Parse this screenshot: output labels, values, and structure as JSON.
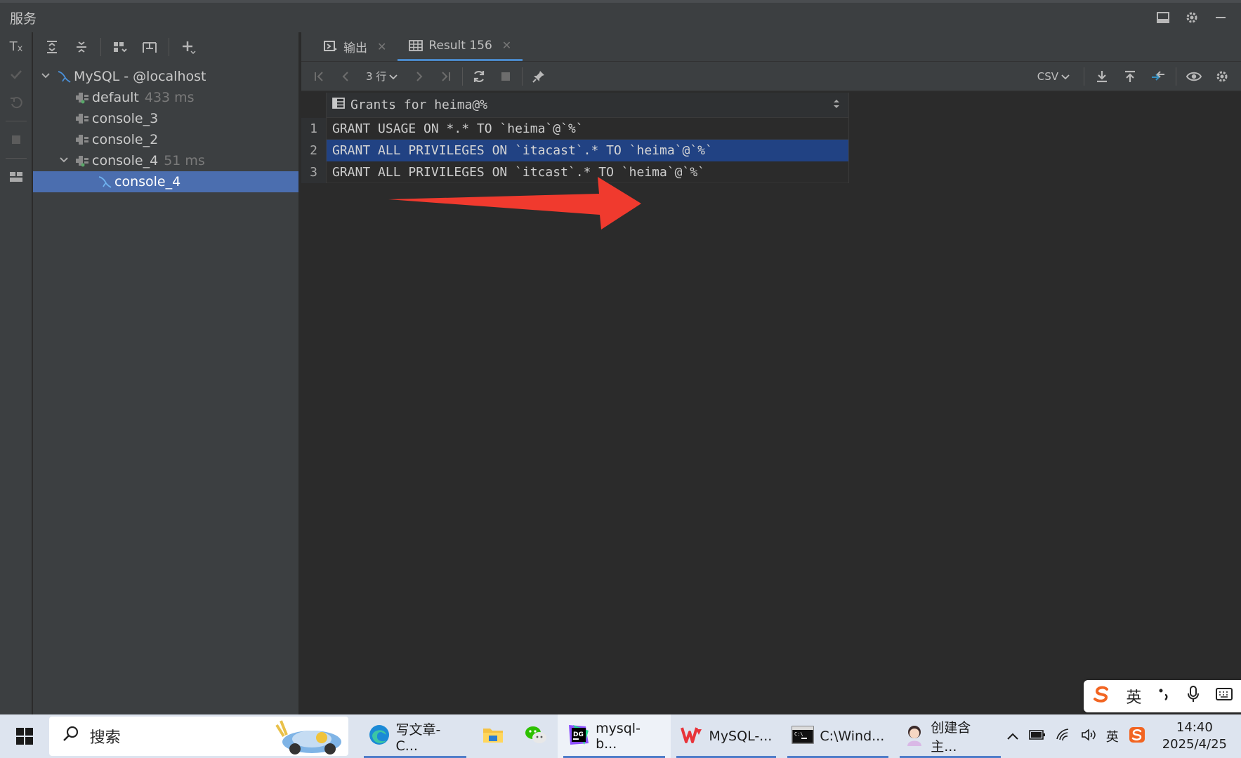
{
  "window": {
    "title": "服务"
  },
  "tree": {
    "items": [
      {
        "label": "MySQL - @localhost",
        "time": ""
      },
      {
        "label": "default",
        "time": "433 ms"
      },
      {
        "label": "console_3",
        "time": ""
      },
      {
        "label": "console_2",
        "time": ""
      },
      {
        "label": "console_4",
        "time": "51 ms"
      },
      {
        "label": "console_4",
        "time": ""
      }
    ]
  },
  "tabs": [
    {
      "label": "输出"
    },
    {
      "label": "Result 156"
    }
  ],
  "result_toolbar": {
    "row_count": "3 行",
    "export_format": "CSV"
  },
  "grid": {
    "column": "Grants for heima@%",
    "rows": [
      {
        "num": "1",
        "value": "GRANT USAGE ON *.* TO `heima`@`%`"
      },
      {
        "num": "2",
        "value": "GRANT ALL PRIVILEGES ON `itacast`.* TO `heima`@`%`"
      },
      {
        "num": "3",
        "value": "GRANT ALL PRIVILEGES ON `itcast`.* TO `heima`@`%`"
      }
    ]
  },
  "ime": {
    "mode": "英"
  },
  "taskbar": {
    "search_placeholder": "搜索",
    "items": [
      {
        "label": "写文章-C...",
        "icon": "edge-icon"
      },
      {
        "label": "",
        "icon": "folder-icon"
      },
      {
        "label": "",
        "icon": "wechat-icon"
      },
      {
        "label": "mysql-b...",
        "icon": "datagrip-icon"
      },
      {
        "label": "MySQL-...",
        "icon": "wps-icon"
      },
      {
        "label": "C:\\Wind...",
        "icon": "cmd-icon"
      },
      {
        "label": "创建含主...",
        "icon": "avatar-icon"
      }
    ],
    "tray_lang": "英",
    "time": "14:40",
    "date": "2025/4/25"
  },
  "colors": {
    "selection_tree": "#4b6eaf",
    "selection_grid": "#214283",
    "annotation_arrow": "#f03a2e"
  }
}
